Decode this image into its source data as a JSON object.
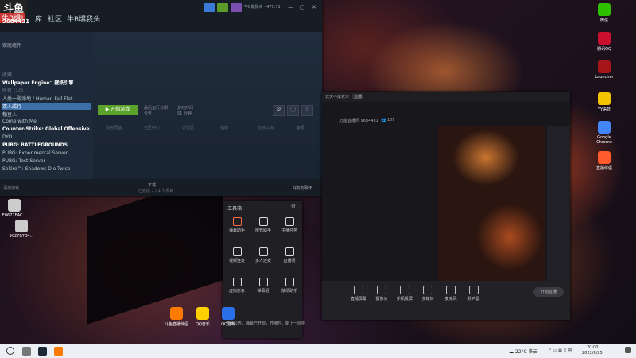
{
  "overlay": {
    "logo": "斗鱼",
    "tag": "牛B爆!",
    "room_id": "9684431"
  },
  "steam": {
    "nav": [
      "库",
      "社区",
      "牛B爆我头"
    ],
    "user": "牛B爆我头 · 479.71",
    "window_controls": [
      "—",
      "▢",
      "✕"
    ],
    "sidebar": {
      "header": "家庭组件",
      "rows": [
        {
          "label": "收藏",
          "style": "dim"
        },
        {
          "label": "Wallpaper Engine：壁纸引擎",
          "style": "strong"
        },
        {
          "label": "所有 (10)",
          "style": "dim"
        },
        {
          "label": "人类一败涂地 / Human Fall Flat",
          "style": "normal"
        },
        {
          "label": "双人成行",
          "style": "sel"
        },
        {
          "label": "糖豆人",
          "style": "normal"
        },
        {
          "label": "Come with Me",
          "style": "normal"
        },
        {
          "label": "Counter-Strike: Global Offensive",
          "style": "strong"
        },
        {
          "label": "DYO",
          "style": "normal"
        },
        {
          "label": "PUBG: BATTLEGROUNDS",
          "style": "strong"
        },
        {
          "label": "PUBG: Experimental Server",
          "style": "normal"
        },
        {
          "label": "PUBG: Test Server",
          "style": "normal"
        },
        {
          "label": "Sekiro™: Shadows Die Twice",
          "style": "normal"
        }
      ],
      "footer": "添加游戏"
    },
    "main": {
      "play_label": "▶ 开始游戏",
      "last_played_label": "最后运行日期",
      "last_played_value": "今天",
      "playtime_label": "游戏时间",
      "playtime_value": "51 分钟",
      "tabs": [
        "商店页面",
        "社区中心",
        "讨论区",
        "指南",
        "创意工坊",
        "客服"
      ]
    },
    "bottom": {
      "downloads": "下载",
      "downloads_sub": "已完成 1 / 1 个项目",
      "friends": "好友与聊天"
    }
  },
  "live": {
    "title": "云天不成老末",
    "badge": "直播",
    "room_line": "万能直播间  9684431",
    "fans": "👥 187",
    "buttons": [
      "直播屏幕",
      "摄像头",
      "手机投屏",
      "多媒体",
      "麦克风",
      "扬声器"
    ],
    "start": "开始直播"
  },
  "toolbox": {
    "title": "工具箱",
    "items": [
      {
        "label": "弹幕助手",
        "hot": true
      },
      {
        "label": "房管助手",
        "hot": false
      },
      {
        "label": "主播任务",
        "hot": false
      },
      {
        "label": "视频连麦",
        "hot": false
      },
      {
        "label": "多人连麦",
        "hot": false
      },
      {
        "label": "直播间",
        "hot": false
      },
      {
        "label": "虚拟形象",
        "hot": false
      },
      {
        "label": "弹幕姬",
        "hot": false
      },
      {
        "label": "散场助手",
        "hot": false
      }
    ],
    "footer": "开播公告，弹幕已开启，开播时，新上一层楼"
  },
  "desktop_icons": [
    {
      "label": "微信",
      "color": "#2dc100"
    },
    {
      "label": "腾讯QQ",
      "color": "#c8102e"
    },
    {
      "label": "Launcher",
      "color": "#a4161a"
    },
    {
      "label": "YY语音",
      "color": "#f5c400"
    },
    {
      "label": "Google Chrome",
      "color": "#4285f4"
    },
    {
      "label": "直播伴侣",
      "color": "#ff5a2c"
    },
    {
      "label": "斗鱼直播伴侣",
      "color": "#ff7a00"
    },
    {
      "label": "QQ音乐",
      "color": "#ffd000"
    },
    {
      "label": "QQ游戏",
      "color": "#2a6ee8"
    },
    {
      "label": "9027B7B4...",
      "color": "#ccc"
    },
    {
      "label": "E0677EAC...",
      "color": "#ccc"
    }
  ],
  "taskbar": {
    "weather": "☁ 22°C 多云",
    "time": "20:00",
    "date": "2022/6/25"
  }
}
